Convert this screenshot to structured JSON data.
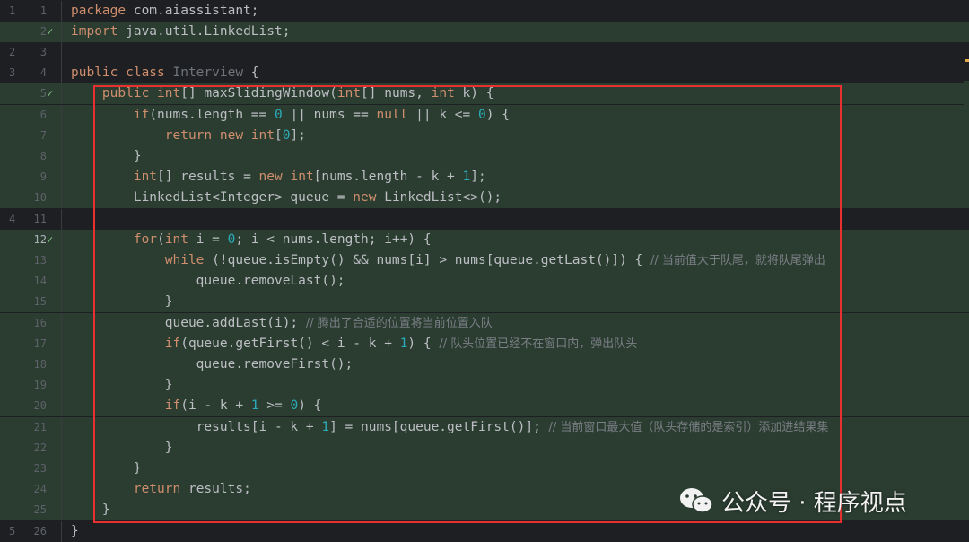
{
  "editor": {
    "lines": [
      {
        "ln_left": "1",
        "ln_right": "1",
        "check": false,
        "bg": "plain",
        "segments": [
          {
            "t": "kw",
            "v": "package"
          },
          {
            "t": "txt",
            "v": " com.aiassistant;"
          }
        ]
      },
      {
        "ln_left": "",
        "ln_right": "2",
        "check": true,
        "bg": "green",
        "segments": [
          {
            "t": "kw",
            "v": "import"
          },
          {
            "t": "txt",
            "v": " java.util.LinkedList;"
          }
        ]
      },
      {
        "ln_left": "2",
        "ln_right": "3",
        "check": false,
        "bg": "plain",
        "segments": []
      },
      {
        "ln_left": "3",
        "ln_right": "4",
        "check": false,
        "bg": "plain",
        "segments": [
          {
            "t": "kw",
            "v": "public class"
          },
          {
            "t": "cls",
            "v": " Interview"
          },
          {
            "t": "txt",
            "v": " {"
          }
        ]
      },
      {
        "ln_left": "",
        "ln_right": "5",
        "check": true,
        "bg": "green",
        "segments": [
          {
            "t": "txt",
            "v": "    "
          },
          {
            "t": "kw",
            "v": "public int"
          },
          {
            "t": "txt",
            "v": "[] maxSlidingWindow("
          },
          {
            "t": "kw",
            "v": "int"
          },
          {
            "t": "txt",
            "v": "[] nums, "
          },
          {
            "t": "kw",
            "v": "int"
          },
          {
            "t": "txt",
            "v": " k) {"
          }
        ]
      },
      {
        "ln_left": "",
        "ln_right": "6",
        "check": false,
        "bg": "green",
        "segments": [
          {
            "t": "txt",
            "v": "        "
          },
          {
            "t": "kw",
            "v": "if"
          },
          {
            "t": "txt",
            "v": "(nums.length == "
          },
          {
            "t": "num",
            "v": "0"
          },
          {
            "t": "txt",
            "v": " || nums == "
          },
          {
            "t": "kw",
            "v": "null"
          },
          {
            "t": "txt",
            "v": " || k <= "
          },
          {
            "t": "num",
            "v": "0"
          },
          {
            "t": "txt",
            "v": ") {"
          }
        ]
      },
      {
        "ln_left": "",
        "ln_right": "7",
        "check": false,
        "bg": "green",
        "segments": [
          {
            "t": "txt",
            "v": "            "
          },
          {
            "t": "kw",
            "v": "return new int"
          },
          {
            "t": "txt",
            "v": "["
          },
          {
            "t": "num",
            "v": "0"
          },
          {
            "t": "txt",
            "v": "];"
          }
        ]
      },
      {
        "ln_left": "",
        "ln_right": "8",
        "check": false,
        "bg": "green",
        "segments": [
          {
            "t": "txt",
            "v": "        }"
          }
        ]
      },
      {
        "ln_left": "",
        "ln_right": "9",
        "check": false,
        "bg": "green",
        "segments": [
          {
            "t": "txt",
            "v": "        "
          },
          {
            "t": "kw",
            "v": "int"
          },
          {
            "t": "txt",
            "v": "[] results = "
          },
          {
            "t": "kw",
            "v": "new int"
          },
          {
            "t": "txt",
            "v": "[nums.length - k + "
          },
          {
            "t": "num",
            "v": "1"
          },
          {
            "t": "txt",
            "v": "];"
          }
        ]
      },
      {
        "ln_left": "",
        "ln_right": "10",
        "check": false,
        "bg": "green",
        "segments": [
          {
            "t": "txt",
            "v": "        LinkedList<Integer> queue = "
          },
          {
            "t": "kw",
            "v": "new"
          },
          {
            "t": "txt",
            "v": " LinkedList<>();"
          }
        ]
      },
      {
        "ln_left": "4",
        "ln_right": "11",
        "check": false,
        "bg": "plain",
        "segments": []
      },
      {
        "ln_left": "",
        "ln_right": "12",
        "check": true,
        "bg": "green",
        "active": true,
        "segments": [
          {
            "t": "txt",
            "v": "        "
          },
          {
            "t": "kw",
            "v": "for"
          },
          {
            "t": "txt",
            "v": "("
          },
          {
            "t": "kw",
            "v": "int"
          },
          {
            "t": "txt",
            "v": " i = "
          },
          {
            "t": "num",
            "v": "0"
          },
          {
            "t": "txt",
            "v": "; i < nums.length; i++) {"
          }
        ]
      },
      {
        "ln_left": "",
        "ln_right": "13",
        "check": false,
        "bg": "green",
        "segments": [
          {
            "t": "txt",
            "v": "            "
          },
          {
            "t": "kw",
            "v": "while"
          },
          {
            "t": "txt",
            "v": " (!queue.isEmpty() && nums[i] > nums[queue.getLast()]) { "
          },
          {
            "t": "cmt",
            "v": "// 当前值大于队尾，就将队尾弹出"
          }
        ]
      },
      {
        "ln_left": "",
        "ln_right": "14",
        "check": false,
        "bg": "green",
        "segments": [
          {
            "t": "txt",
            "v": "                queue.removeLast();"
          }
        ]
      },
      {
        "ln_left": "",
        "ln_right": "15",
        "check": false,
        "bg": "green",
        "segments": [
          {
            "t": "txt",
            "v": "            }"
          }
        ]
      },
      {
        "ln_left": "",
        "ln_right": "16",
        "check": false,
        "bg": "green",
        "segments": [
          {
            "t": "txt",
            "v": "            queue.addLast(i); "
          },
          {
            "t": "cmt",
            "v": "// 腾出了合适的位置将当前位置入队"
          }
        ]
      },
      {
        "ln_left": "",
        "ln_right": "17",
        "check": false,
        "bg": "green",
        "segments": [
          {
            "t": "txt",
            "v": "            "
          },
          {
            "t": "kw",
            "v": "if"
          },
          {
            "t": "txt",
            "v": "(queue.getFirst() < i - k + "
          },
          {
            "t": "num",
            "v": "1"
          },
          {
            "t": "txt",
            "v": ") { "
          },
          {
            "t": "cmt",
            "v": "// 队头位置已经不在窗口内，弹出队头"
          }
        ]
      },
      {
        "ln_left": "",
        "ln_right": "18",
        "check": false,
        "bg": "green",
        "segments": [
          {
            "t": "txt",
            "v": "                queue.removeFirst();"
          }
        ]
      },
      {
        "ln_left": "",
        "ln_right": "19",
        "check": false,
        "bg": "green",
        "segments": [
          {
            "t": "txt",
            "v": "            }"
          }
        ]
      },
      {
        "ln_left": "",
        "ln_right": "20",
        "check": false,
        "bg": "green",
        "segments": [
          {
            "t": "txt",
            "v": "            "
          },
          {
            "t": "kw",
            "v": "if"
          },
          {
            "t": "txt",
            "v": "(i - k + "
          },
          {
            "t": "num",
            "v": "1"
          },
          {
            "t": "txt",
            "v": " >= "
          },
          {
            "t": "num",
            "v": "0"
          },
          {
            "t": "txt",
            "v": ") {"
          }
        ]
      },
      {
        "ln_left": "",
        "ln_right": "21",
        "check": false,
        "bg": "green",
        "segments": [
          {
            "t": "txt",
            "v": "                results[i - k + "
          },
          {
            "t": "num",
            "v": "1"
          },
          {
            "t": "txt",
            "v": "] = nums[queue.getFirst()]; "
          },
          {
            "t": "cmt",
            "v": "// 当前窗口最大值（队头存储的是索引）添加进结果集"
          }
        ]
      },
      {
        "ln_left": "",
        "ln_right": "22",
        "check": false,
        "bg": "green",
        "segments": [
          {
            "t": "txt",
            "v": "            }"
          }
        ]
      },
      {
        "ln_left": "",
        "ln_right": "23",
        "check": false,
        "bg": "green",
        "segments": [
          {
            "t": "txt",
            "v": "        }"
          }
        ]
      },
      {
        "ln_left": "",
        "ln_right": "24",
        "check": false,
        "bg": "green",
        "segments": [
          {
            "t": "txt",
            "v": "        "
          },
          {
            "t": "kw",
            "v": "return"
          },
          {
            "t": "txt",
            "v": " results;"
          }
        ]
      },
      {
        "ln_left": "",
        "ln_right": "25",
        "check": false,
        "bg": "green",
        "segments": [
          {
            "t": "txt",
            "v": "    }"
          }
        ]
      },
      {
        "ln_left": "5",
        "ln_right": "26",
        "check": false,
        "bg": "plain",
        "segments": [
          {
            "t": "txt",
            "v": "}"
          }
        ]
      }
    ]
  },
  "watermark": {
    "text": "公众号 · 程序视点",
    "icon": "wechat-icon"
  },
  "colors": {
    "keyword": "#cf8e6d",
    "number": "#2aacb8",
    "comment": "#7a7e85",
    "added_bg": "#2b3d31",
    "highlight_border": "#e8312f"
  }
}
